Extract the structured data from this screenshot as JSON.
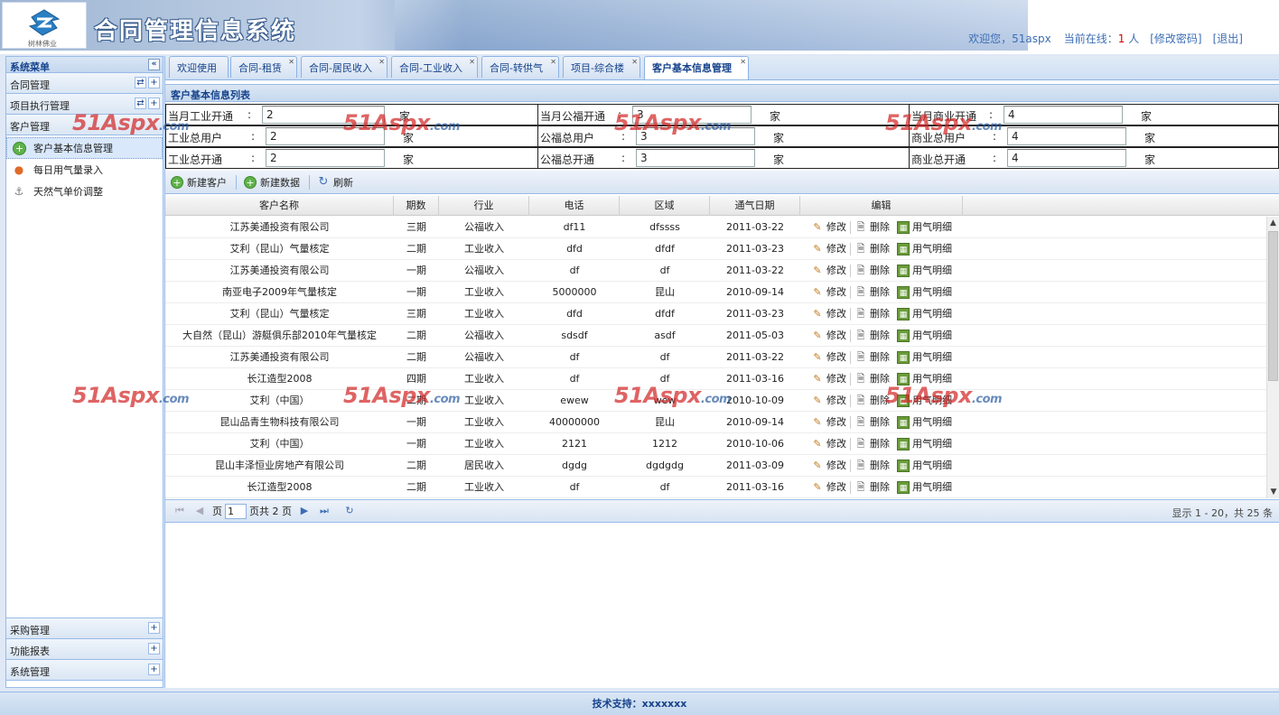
{
  "header": {
    "title": "合同管理信息系统",
    "logo_sub": "树林佛业",
    "welcome": "欢迎您，51aspx",
    "online_label": "当前在线：",
    "online_count": "1",
    "online_unit": " 人",
    "change_pwd": "[修改密码]",
    "logout": "[退出]"
  },
  "sidebar": {
    "title": "系统菜单",
    "collapse_icon": "«",
    "sections_top": [
      {
        "label": "合同管理"
      },
      {
        "label": "项目执行管理"
      },
      {
        "label": "客户管理"
      }
    ],
    "items": [
      {
        "label": "客户基本信息管理",
        "icon": "+"
      },
      {
        "label": "每日用气量录入",
        "icon": "●"
      },
      {
        "label": "天然气单价调整",
        "icon": "⚓"
      }
    ],
    "sections_bottom": [
      {
        "label": "采购管理"
      },
      {
        "label": "功能报表"
      },
      {
        "label": "系统管理"
      }
    ]
  },
  "tabs": [
    {
      "label": "欢迎使用"
    },
    {
      "label": "合同-租赁"
    },
    {
      "label": "合同-居民收入"
    },
    {
      "label": "合同-工业收入"
    },
    {
      "label": "合同-转供气"
    },
    {
      "label": "项目-综合楼"
    },
    {
      "label": "客户基本信息管理"
    }
  ],
  "panel": {
    "title": "客户基本信息列表"
  },
  "stats": {
    "colon": ":",
    "unit": "家",
    "rows": [
      [
        {
          "label": "当月工业开通",
          "value": "2"
        },
        {
          "label": "当月公福开通",
          "value": "3"
        },
        {
          "label": "当月商业开通",
          "value": "4"
        }
      ],
      [
        {
          "label": "工业总用户",
          "value": "2"
        },
        {
          "label": "公福总用户",
          "value": "3"
        },
        {
          "label": "商业总用户",
          "value": "4"
        }
      ],
      [
        {
          "label": "工业总开通",
          "value": "2"
        },
        {
          "label": "公福总开通",
          "value": "3"
        },
        {
          "label": "商业总开通",
          "value": "4"
        }
      ]
    ]
  },
  "toolbar": {
    "new_customer": "新建客户",
    "new_data": "新建数据",
    "refresh": "刷新"
  },
  "grid": {
    "columns": [
      "客户名称",
      "期数",
      "行业",
      "电话",
      "区域",
      "通气日期",
      "编辑"
    ],
    "actions": {
      "edit": "修改",
      "delete": "删除",
      "gas": "用气明细"
    },
    "rows": [
      [
        "江苏美通投资有限公司",
        "三期",
        "公福收入",
        "df11",
        "dfssss",
        "2011-03-22"
      ],
      [
        "艾利（昆山）气量核定",
        "二期",
        "工业收入",
        "dfd",
        "dfdf",
        "2011-03-23"
      ],
      [
        "江苏美通投资有限公司",
        "一期",
        "公福收入",
        "df",
        "df",
        "2011-03-22"
      ],
      [
        "南亚电子2009年气量核定",
        "一期",
        "工业收入",
        "5000000",
        "昆山",
        "2010-09-14"
      ],
      [
        "艾利（昆山）气量核定",
        "三期",
        "工业收入",
        "dfd",
        "dfdf",
        "2011-03-23"
      ],
      [
        "大自然（昆山）游艇俱乐部2010年气量核定",
        "二期",
        "公福收入",
        "sdsdf",
        "asdf",
        "2011-05-03"
      ],
      [
        "江苏美通投资有限公司",
        "二期",
        "公福收入",
        "df",
        "df",
        "2011-03-22"
      ],
      [
        "长江造型2008",
        "四期",
        "工业收入",
        "df",
        "df",
        "2011-03-16"
      ],
      [
        "艾利（中国）",
        "二期",
        "工业收入",
        "ewew",
        "wew",
        "2010-10-09"
      ],
      [
        "昆山品青生物科技有限公司",
        "一期",
        "工业收入",
        "40000000",
        "昆山",
        "2010-09-14"
      ],
      [
        "艾利（中国）",
        "一期",
        "工业收入",
        "2121",
        "1212",
        "2010-10-06"
      ],
      [
        "昆山丰泽恒业房地产有限公司",
        "二期",
        "居民收入",
        "dgdg",
        "dgdgdg",
        "2011-03-09"
      ],
      [
        "长江造型2008",
        "二期",
        "工业收入",
        "df",
        "df",
        "2011-03-16"
      ]
    ]
  },
  "pager": {
    "page_label": "页",
    "page_value": "1",
    "total_label": "页共 2 页",
    "info": "显示 1 - 20，共 25 条"
  },
  "footer": {
    "text": "技术支持：xxxxxxx"
  },
  "watermark": {
    "brand": "51Aspx",
    "suffix": ".com"
  }
}
